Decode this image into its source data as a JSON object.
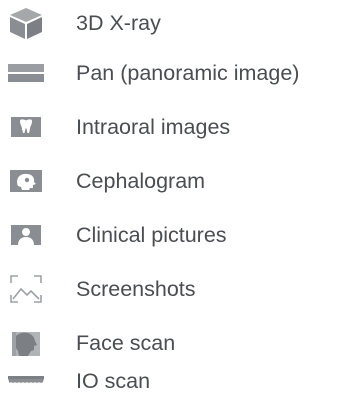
{
  "menu": {
    "items": [
      {
        "label": "3D X-ray",
        "icon": "cube-icon"
      },
      {
        "label": "Pan (panoramic image)",
        "icon": "panoramic-icon"
      },
      {
        "label": "Intraoral images",
        "icon": "tooth-icon"
      },
      {
        "label": "Cephalogram",
        "icon": "skull-profile-icon"
      },
      {
        "label": "Clinical pictures",
        "icon": "person-icon"
      },
      {
        "label": "Screenshots",
        "icon": "screenshot-icon"
      },
      {
        "label": "Face scan",
        "icon": "face-scan-icon"
      },
      {
        "label": "IO scan",
        "icon": "dental-arch-icon"
      }
    ]
  },
  "colors": {
    "icon_gray": "#8e9296",
    "icon_light": "#b5b9bc",
    "text": "#4a4d52"
  }
}
